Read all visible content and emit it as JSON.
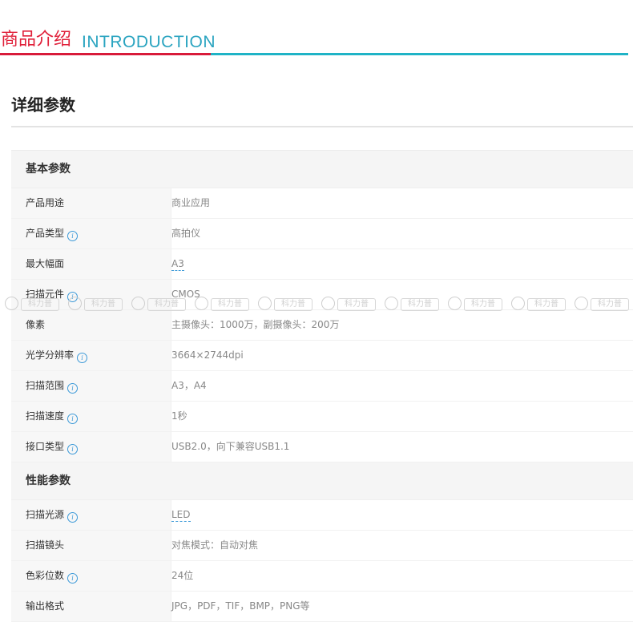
{
  "intro": {
    "title_cn": "商品介绍",
    "title_en": "INTRODUCTION"
  },
  "detail_title": "详细参数",
  "watermark_text": "科力普",
  "sections": [
    {
      "title": "基本参数",
      "rows": [
        {
          "label": "产品用途",
          "value": "商业应用",
          "info": false,
          "dashed": false
        },
        {
          "label": "产品类型",
          "value": "高拍仪",
          "info": true,
          "dashed": false
        },
        {
          "label": "最大幅面",
          "value": "A3",
          "info": false,
          "dashed": true
        },
        {
          "label": "扫描元件",
          "value": "CMOS",
          "info": true,
          "dashed": false
        },
        {
          "label": "像素",
          "value": "主摄像头：1000万，副摄像头：200万",
          "info": false,
          "dashed": false
        },
        {
          "label": "光学分辨率",
          "value": "3664×2744dpi",
          "info": true,
          "dashed": false
        },
        {
          "label": "扫描范围",
          "value": "A3，A4",
          "info": true,
          "dashed": false
        },
        {
          "label": "扫描速度",
          "value": "1秒",
          "info": true,
          "dashed": false
        },
        {
          "label": "接口类型",
          "value": "USB2.0，向下兼容USB1.1",
          "info": true,
          "dashed": false
        }
      ]
    },
    {
      "title": "性能参数",
      "rows": [
        {
          "label": "扫描光源",
          "value": "LED",
          "info": true,
          "dashed": true
        },
        {
          "label": "扫描镜头",
          "value": "对焦模式：自动对焦",
          "info": false,
          "dashed": false
        },
        {
          "label": "色彩位数",
          "value": "24位",
          "info": true,
          "dashed": false
        },
        {
          "label": "输出格式",
          "value": "JPG，PDF，TIF，BMP，PNG等",
          "info": false,
          "dashed": false
        }
      ]
    }
  ]
}
